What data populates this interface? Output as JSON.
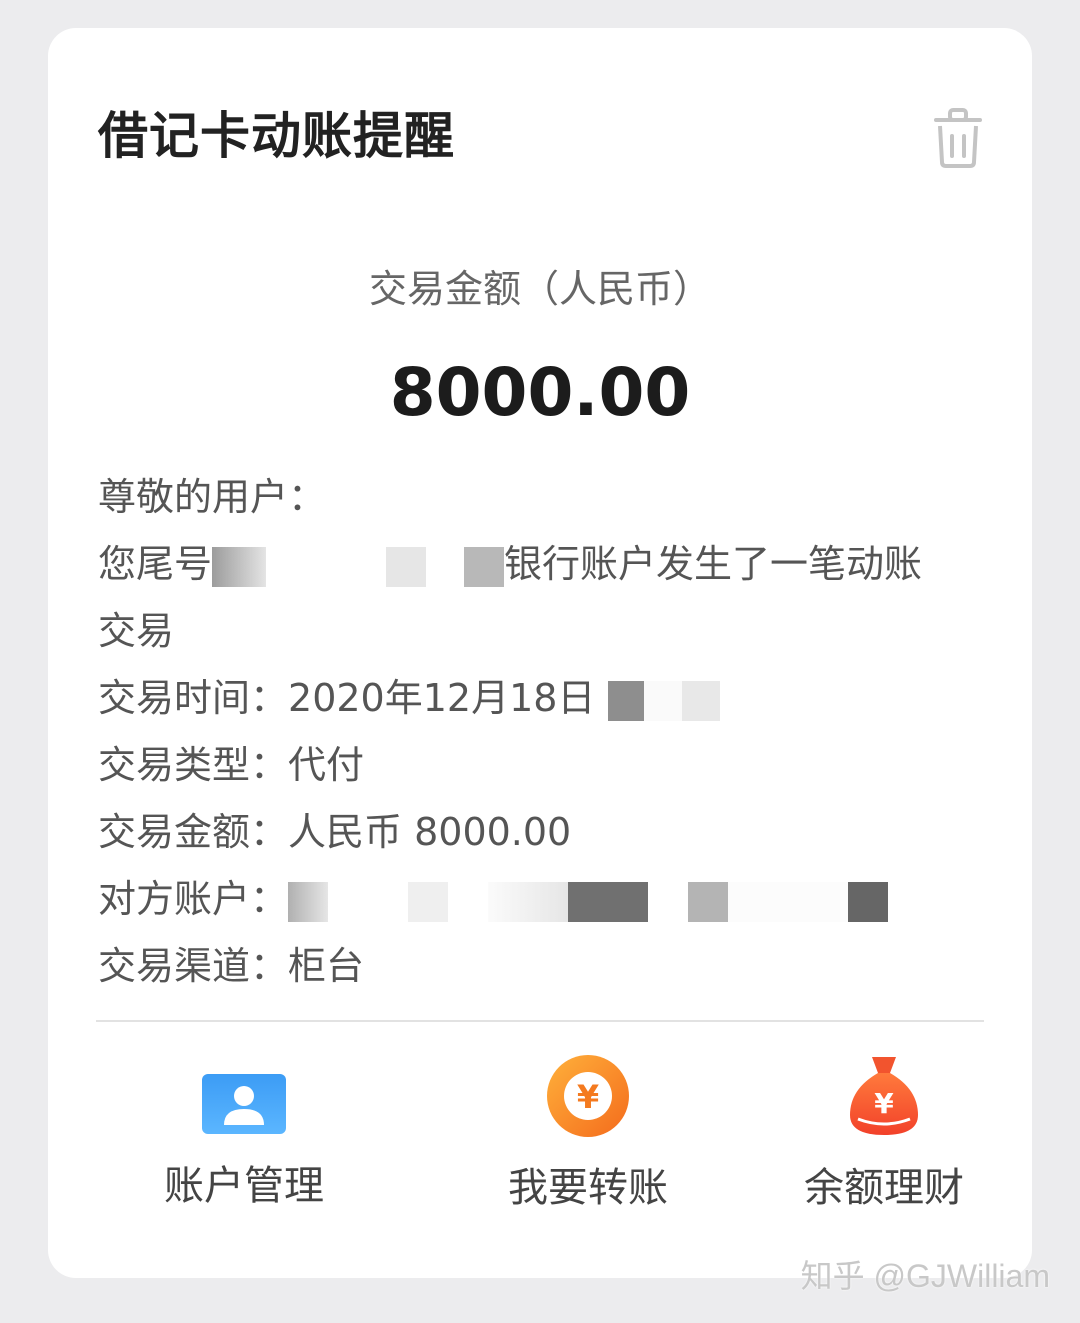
{
  "card": {
    "title": "借记卡动账提醒",
    "delete_icon": "trash-icon",
    "amount_label": "交易金额（人民币）",
    "amount": "8000.00",
    "greeting": "尊敬的用户：",
    "line2_prefix": "您尾号",
    "line2_suffix": "银行账户发生了一笔动账",
    "line3": "交易",
    "time_label": "交易时间：",
    "time_value": "2020年12月18日",
    "type_label": "交易类型：",
    "type_value": "代付",
    "amount_row_label": "交易金额：",
    "amount_row_value": "人民币 8000.00",
    "counterparty_label": "对方账户：",
    "channel_label": "交易渠道：",
    "channel_value": "柜台"
  },
  "actions": [
    {
      "label": "账户管理",
      "icon": "user-card-icon"
    },
    {
      "label": "我要转账",
      "icon": "yuan-coin-icon"
    },
    {
      "label": "余额理财",
      "icon": "money-bag-icon"
    }
  ],
  "watermark": "知乎 @GJWilliam"
}
